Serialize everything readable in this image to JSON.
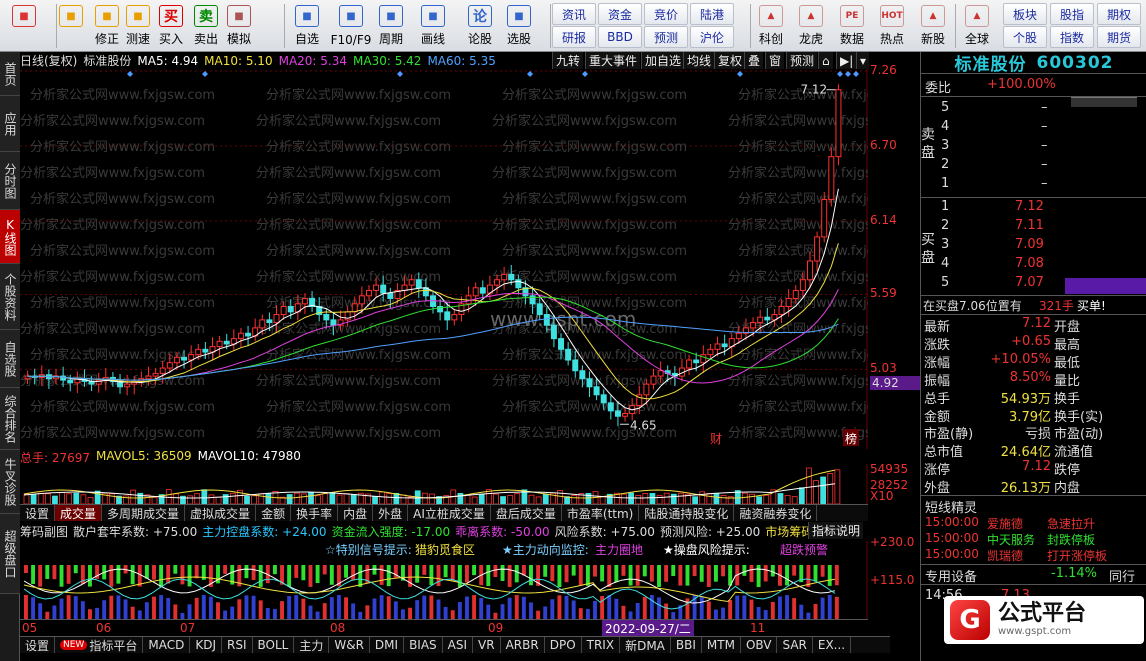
{
  "toolbar": {
    "big_buttons": [
      {
        "label": "",
        "icon": "grid-icon",
        "color": "#d33"
      },
      {
        "label": "",
        "icon": "back-arrow-icon",
        "color": "#e8a000"
      },
      {
        "label": "修正",
        "icon": "arrows-icon",
        "color": "#e8a000"
      },
      {
        "label": "测速",
        "icon": "stopwatch-icon",
        "color": "#e8a000"
      },
      {
        "label": "买入",
        "icon": "buy-icon",
        "glyph": "买",
        "color": "#d00"
      },
      {
        "label": "卖出",
        "icon": "sell-icon",
        "glyph": "卖",
        "color": "#080"
      },
      {
        "label": "模拟",
        "icon": "hammer-icon",
        "color": "#a55"
      },
      {
        "label": "自选",
        "icon": "star-icon",
        "color": "#36c"
      },
      {
        "label": "F10/F9",
        "icon": "window-icon",
        "color": "#36c"
      },
      {
        "label": "周期",
        "icon": "clock-icon",
        "color": "#36c"
      },
      {
        "label": "画线",
        "icon": "pencil-icon",
        "color": "#36c"
      },
      {
        "label": "论股",
        "icon": "talk-icon",
        "glyph": "论",
        "color": "#36c"
      },
      {
        "label": "选股",
        "icon": "gauge-icon",
        "color": "#36c"
      }
    ],
    "small_buttons_top": [
      "资讯",
      "资金",
      "竞价",
      "陆港"
    ],
    "small_buttons_bottom": [
      "研报",
      "BBD",
      "预测",
      "沪伦"
    ],
    "right_buttons": [
      {
        "label": "科创",
        "icon": "chart-icon"
      },
      {
        "label": "龙虎",
        "icon": "dragon-icon"
      },
      {
        "label": "数据",
        "icon": "pe-icon",
        "glyph": "PE"
      },
      {
        "label": "热点",
        "icon": "hot-icon",
        "glyph": "HOT"
      },
      {
        "label": "新股",
        "icon": "newstock-icon"
      },
      {
        "label": "全球",
        "icon": "globe-icon"
      }
    ],
    "far_right_top": [
      "板块",
      "股指",
      "期权"
    ],
    "far_right_bottom": [
      "个股",
      "指数",
      "期货"
    ]
  },
  "left_tabs": [
    {
      "label": "首页",
      "active": false
    },
    {
      "label": "应用",
      "active": false
    },
    {
      "label": "分时图",
      "active": false
    },
    {
      "label": "K线图",
      "active": true
    },
    {
      "label": "个股资料",
      "active": false
    },
    {
      "label": "自选股",
      "active": false
    },
    {
      "label": "综合排名",
      "active": false
    },
    {
      "label": "牛叉诊股",
      "active": false
    },
    {
      "label": "超级盘口",
      "active": false
    }
  ],
  "chart_header": {
    "period": "日线(复权)",
    "stock": "标准股份",
    "ma5": "MA5: 4.94",
    "ma10": "MA10: 5.10",
    "ma20": "MA20: 5.34",
    "ma30": "MA30: 5.42",
    "ma60": "MA60: 5.35",
    "right_buttons": [
      "九转",
      "重大事件",
      "加自选",
      "均线",
      "复权",
      "叠",
      "窗",
      "预测"
    ]
  },
  "colors": {
    "ma5": "#ffffff",
    "ma10": "#f0e040",
    "ma20": "#e040e0",
    "ma30": "#30e030",
    "ma60": "#50a0ff",
    "up": "#ff3030",
    "down": "#40e0e0",
    "grid": "#6b0000"
  },
  "price_axis": [
    {
      "value": "7.26",
      "price": 7.26
    },
    {
      "value": "6.70",
      "price": 6.7
    },
    {
      "value": "6.14",
      "price": 6.14
    },
    {
      "value": "5.59",
      "price": 5.59
    },
    {
      "value": "5.03",
      "price": 5.03
    },
    {
      "value": "4.92",
      "price": 4.92,
      "highlight": true
    }
  ],
  "annotations": {
    "high": "7.12",
    "low": "4.65",
    "watermark": "分析家公式网www.fxjgsw.com",
    "center_watermark": "www.gspt.com",
    "marker_cai": "财",
    "marker_bang": "榜"
  },
  "volume": {
    "header": [
      "总手: 27697",
      "MAVOL5: 36509",
      "MAVOL10: 47980"
    ],
    "axis": [
      "54935",
      "28252",
      "X10"
    ]
  },
  "volume_tabs": [
    "设置",
    "成交量",
    "多周期成交量",
    "虚拟成交量",
    "金额",
    "换手率",
    "内盘",
    "外盘",
    "AI立桩成交量",
    "盘后成交量",
    "市盈率(ttm)",
    "陆股通持股变化",
    "融资融券变化"
  ],
  "indicator2": {
    "header": [
      "筹码副图",
      "散户套牢系数: +75.00",
      "主力控盘系数: +24.00",
      "资金流入强度: -17.00",
      "乖离系数: -50.00",
      "风险系数: +75.00",
      "预测风险: +25.00",
      "市场筹码总"
    ],
    "explain_button": "指标说明",
    "signal_text_1": "☆特别信号提示:",
    "signal_text_2": "猎豹觅食区",
    "signal_text_3": "★主力动向监控:",
    "signal_text_4": "主力圈地",
    "signal_text_5": "★操盘风险提示:",
    "signal_text_6": "超跌预警",
    "axis": [
      "+230.0",
      "+115.0"
    ]
  },
  "dates": [
    "05",
    "06",
    "07",
    "08",
    "09",
    "10",
    "11"
  ],
  "selected_date": "2022-09-27/二",
  "bottom_tabs": [
    "设置",
    "指标平台",
    "MACD",
    "KDJ",
    "RSI",
    "BOLL",
    "主力",
    "W&R",
    "DMI",
    "BIAS",
    "ASI",
    "VR",
    "ARBR",
    "DPO",
    "TRIX",
    "新DMA",
    "BBI",
    "MTM",
    "OBV",
    "SAR",
    "EX..."
  ],
  "new_badge": "NEW",
  "right_panel": {
    "title": "标准股份",
    "code": "600302",
    "weibi_label": "委比",
    "weibi_value": "+100.00%",
    "sell_label": "卖盘",
    "buy_label": "买盘",
    "sell": [
      {
        "level": "5",
        "price": "",
        "vol": "–"
      },
      {
        "level": "4",
        "price": "",
        "vol": "–"
      },
      {
        "level": "3",
        "price": "",
        "vol": "–"
      },
      {
        "level": "2",
        "price": "",
        "vol": "–"
      },
      {
        "level": "1",
        "price": "",
        "vol": "–"
      }
    ],
    "buy": [
      {
        "level": "1",
        "price": "7.12",
        "vol": ""
      },
      {
        "level": "2",
        "price": "7.11",
        "vol": ""
      },
      {
        "level": "3",
        "price": "7.09",
        "vol": ""
      },
      {
        "level": "4",
        "price": "7.08",
        "vol": ""
      },
      {
        "level": "5",
        "price": "7.07",
        "vol": ""
      }
    ],
    "inner_line": [
      "在买盘7.06位置有",
      "321手",
      "买单!"
    ],
    "quotes": [
      [
        "最新",
        "7.12",
        "开盘",
        ""
      ],
      [
        "涨跌",
        "+0.65",
        "最高",
        ""
      ],
      [
        "涨幅",
        "+10.05%",
        "最低",
        ""
      ],
      [
        "振幅",
        "8.50%",
        "量比",
        ""
      ],
      [
        "总手",
        "54.93万",
        "换手",
        ""
      ],
      [
        "金额",
        "3.79亿",
        "换手(实)",
        ""
      ],
      [
        "市盈(静)",
        "亏损",
        "市盈(动)",
        ""
      ],
      [
        "总市值",
        "24.64亿",
        "流通值",
        ""
      ],
      [
        "涨停",
        "7.12",
        "跌停",
        ""
      ],
      [
        "外盘",
        "26.13万",
        "内盘",
        ""
      ]
    ],
    "short_title": "短线精灵",
    "short_items": [
      [
        "15:00:00",
        "爱施德",
        "急速拉升"
      ],
      [
        "15:00:00",
        "中天服务",
        "封跌停板"
      ],
      [
        "15:00:00",
        "凯瑞德",
        "打开涨停板"
      ]
    ],
    "equip_label": "专用设备",
    "equip_change": "-1.14%",
    "equip_tail": "同行",
    "time_row": [
      "14:56",
      "7.13"
    ]
  },
  "logo": {
    "mark": "G",
    "text": "公式平台",
    "sub": "www.gspt.com"
  }
}
